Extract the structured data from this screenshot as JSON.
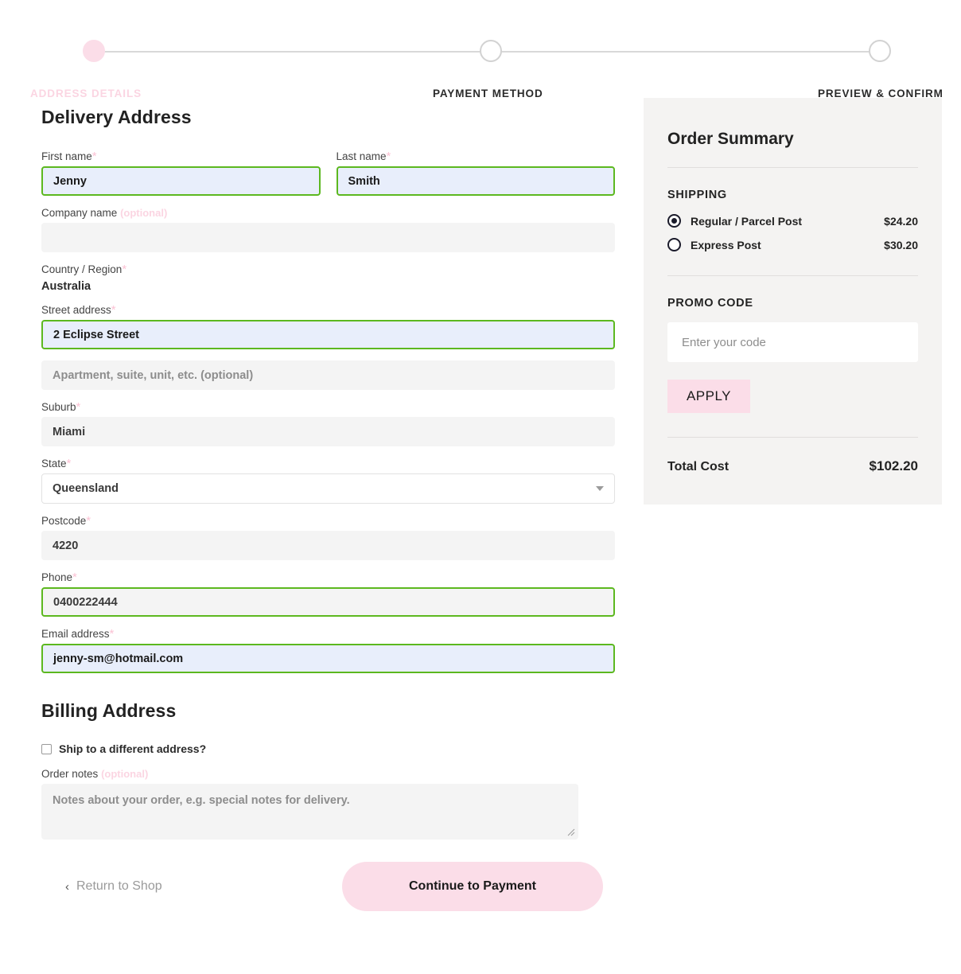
{
  "stepper": {
    "steps": [
      {
        "label": "ADDRESS DETAILS",
        "state": "active"
      },
      {
        "label": "PAYMENT METHOD",
        "state": "upcoming"
      },
      {
        "label": "PREVIEW & CONFIRM",
        "state": "upcoming"
      }
    ],
    "active_color": "#fbdde8",
    "line_color": "#d8d8d8"
  },
  "delivery": {
    "title": "Delivery Address",
    "first_name": {
      "label": "First name",
      "required_mark": "*",
      "value": "Jenny"
    },
    "last_name": {
      "label": "Last name",
      "required_mark": "*",
      "value": "Smith"
    },
    "company": {
      "label": "Company name",
      "optional_text": "(optional)",
      "value": "",
      "placeholder": ""
    },
    "country": {
      "label": "Country / Region",
      "required_mark": "*",
      "value": "Australia"
    },
    "street": {
      "label": "Street address",
      "required_mark": "*",
      "value": "2 Eclipse Street"
    },
    "apartment": {
      "placeholder": "Apartment, suite, unit, etc. (optional)",
      "value": ""
    },
    "suburb": {
      "label": "Suburb",
      "required_mark": "*",
      "value": "Miami"
    },
    "state": {
      "label": "State",
      "required_mark": "*",
      "value": "Queensland"
    },
    "postcode": {
      "label": "Postcode",
      "required_mark": "*",
      "value": "4220"
    },
    "phone": {
      "label": "Phone",
      "required_mark": "*",
      "value": "0400222444"
    },
    "email": {
      "label": "Email address",
      "required_mark": "*",
      "value": "jenny-sm@hotmail.com"
    }
  },
  "billing": {
    "title": "Billing Address",
    "ship_different_label": "Ship to a different address?",
    "ship_different_checked": false,
    "order_notes": {
      "label": "Order notes",
      "optional_text": "(optional)",
      "placeholder": "Notes about your order, e.g. special notes for delivery.",
      "value": ""
    }
  },
  "footer": {
    "return_label": "Return to Shop",
    "return_chevron": "chevron-left-icon",
    "continue_label": "Continue to Payment"
  },
  "summary": {
    "title": "Order Summary",
    "shipping_heading": "SHIPPING",
    "shipping_options": [
      {
        "label": "Regular / Parcel Post",
        "price": "$24.20",
        "selected": true
      },
      {
        "label": "Express Post",
        "price": "$30.20",
        "selected": false
      }
    ],
    "promo_heading": "PROMO CODE",
    "promo_placeholder": "Enter your code",
    "promo_value": "",
    "apply_label": "APPLY",
    "total_label": "Total Cost",
    "total_value": "$102.20",
    "panel_bg": "#f4f3f2",
    "accent_pink": "#fbdde8"
  }
}
